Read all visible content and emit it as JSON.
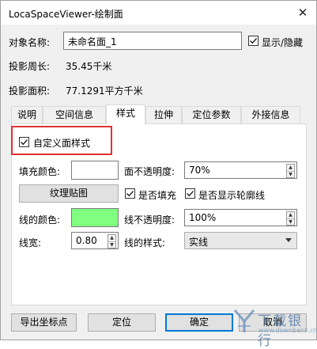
{
  "window": {
    "title": "LocaSpaceViewer-绘制面",
    "close_glyph": "✕"
  },
  "object": {
    "name_label": "对象名称:",
    "name_value": "未命名面_1",
    "visibility_label": "显示/隐藏",
    "visibility_checked": true,
    "perimeter_label": "投影周长:",
    "perimeter_value": "35.45千米",
    "area_label": "投影面积:",
    "area_value": "77.1291平方千米"
  },
  "tabs": [
    {
      "label": "说明"
    },
    {
      "label": "空间信息"
    },
    {
      "label": "样式",
      "active": true
    },
    {
      "label": "拉伸"
    },
    {
      "label": "定位参数"
    },
    {
      "label": "外接信息"
    }
  ],
  "style": {
    "custom_style_label": "自定义面样式",
    "custom_style_checked": true,
    "fill_color_label": "填充颜色:",
    "fill_color": "#ffffff",
    "face_opacity_label": "面不透明度:",
    "face_opacity_value": "70%",
    "texture_button": "纹理贴图",
    "is_fill_label": "是否填充",
    "is_fill_checked": true,
    "show_outline_label": "是否显示轮廓线",
    "show_outline_checked": true,
    "line_color_label": "线的颜色:",
    "line_color": "#80ff80",
    "line_opacity_label": "线不透明度:",
    "line_opacity_value": "100%",
    "line_width_label": "线宽:",
    "line_width_value": "0.80",
    "line_style_label": "线的样式:",
    "line_style_value": "实线"
  },
  "buttons": {
    "export": "导出坐标点",
    "locate": "定位",
    "ok": "确定",
    "cancel": "取消"
  },
  "watermark": {
    "text": "下载银行",
    "url": "www.downbank.cn"
  },
  "colors": {
    "highlight": "#e03030",
    "accent": "#0078d7"
  }
}
